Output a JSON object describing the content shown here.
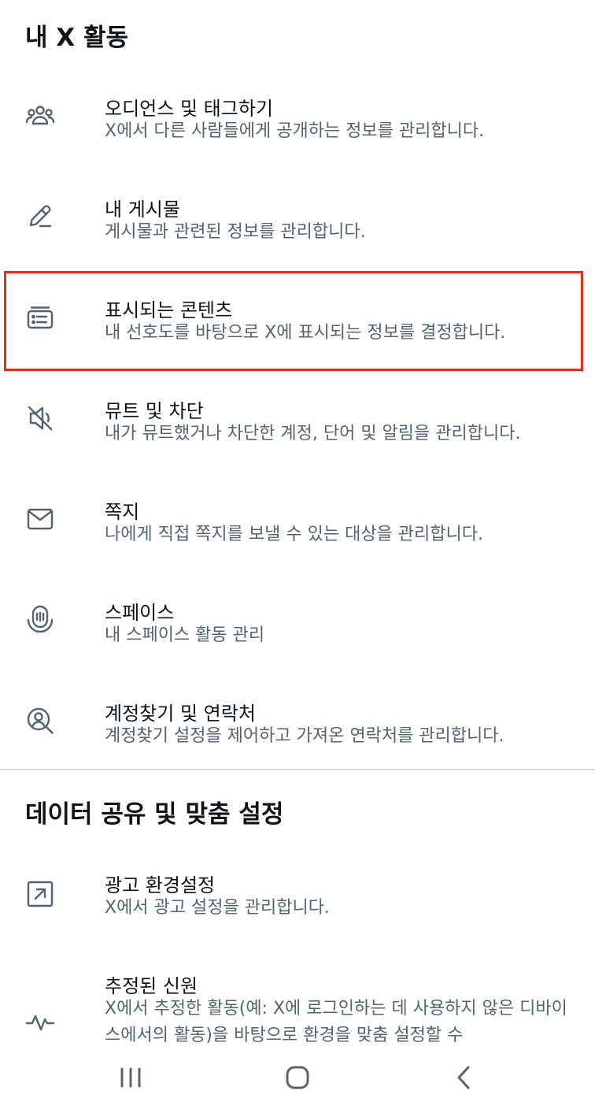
{
  "sections": {
    "activity_title": "내 X 활동",
    "data_title": "데이터 공유 및 맞춤 설정"
  },
  "activity_items": [
    {
      "icon": "audience-icon",
      "title": "오디언스 및 태그하기",
      "desc": "X에서 다른 사람들에게 공개하는 정보를 관리합니다."
    },
    {
      "icon": "pencil-icon",
      "title": "내 게시물",
      "desc": "게시물과 관련된 정보를 관리합니다."
    },
    {
      "icon": "content-card-icon",
      "title": "표시되는 콘텐츠",
      "desc": "내 선호도를 바탕으로 X에 표시되는 정보를 결정합니다."
    },
    {
      "icon": "mute-speaker-icon",
      "title": "뮤트 및 차단",
      "desc": "내가 뮤트했거나 차단한 계정, 단어 및 알림을 관리합니다."
    },
    {
      "icon": "envelope-icon",
      "title": "쪽지",
      "desc": "나에게 직접 쪽지를 보낼 수 있는 대상을 관리합니다."
    },
    {
      "icon": "spaces-icon",
      "title": "스페이스",
      "desc": "내 스페이스 활동 관리"
    },
    {
      "icon": "person-search-icon",
      "title": "계정찾기 및 연락처",
      "desc": "계정찾기 설정을 제어하고 가져온 연락처를 관리합니다."
    }
  ],
  "data_items": [
    {
      "icon": "external-arrow-icon",
      "title": "광고 환경설정",
      "desc": "X에서 광고 설정을 관리합니다."
    },
    {
      "icon": "activity-pulse-icon",
      "title": "추정된 신원",
      "desc": "X에서 추정한 활동(예: X에 로그인하는 데 사용하지 않은 디바이스에서의 활동)을 바탕으로 환경을 맞춤 설정할 수"
    }
  ],
  "navbar": {
    "recent_icon": "recent-apps-icon",
    "home_icon": "home-icon",
    "back_icon": "back-icon"
  },
  "colors": {
    "highlight": "#e0321c",
    "secondary_text": "#536471",
    "primary_text": "#0f1419"
  }
}
